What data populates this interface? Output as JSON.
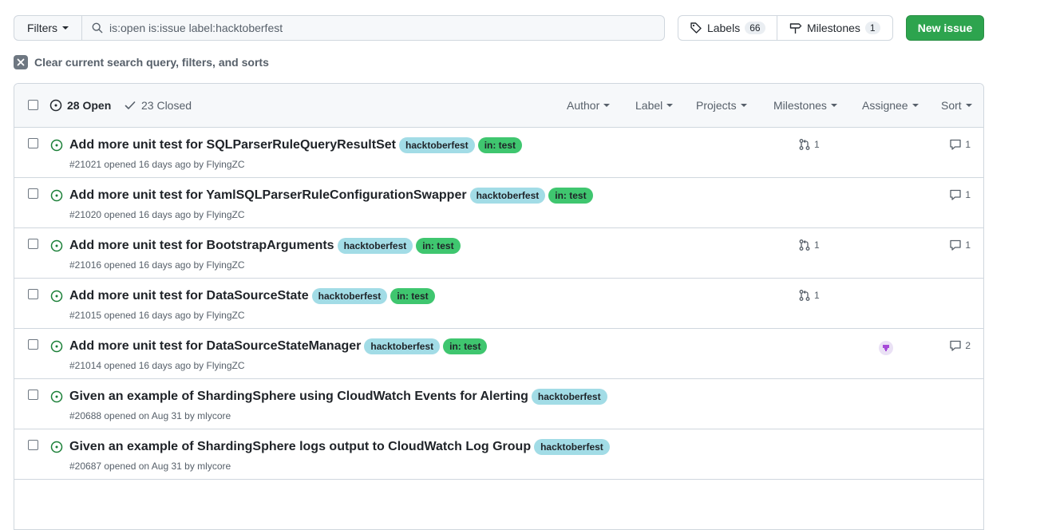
{
  "toolbar": {
    "filters_label": "Filters",
    "search_value": "is:open is:issue label:hacktoberfest",
    "labels_label": "Labels",
    "labels_count": "66",
    "milestones_label": "Milestones",
    "milestones_count": "1",
    "new_issue_label": "New issue"
  },
  "clear_query_label": "Clear current search query, filters, and sorts",
  "list_header": {
    "open_label": "28 Open",
    "closed_label": "23 Closed",
    "sorters": [
      "Author",
      "Label",
      "Projects",
      "Milestones",
      "Assignee",
      "Sort"
    ]
  },
  "colors": {
    "hacktoberfest_label": "#a2dce6",
    "in_test_label": "#3fc66f",
    "open_icon": "#1a7f37",
    "new_issue_button": "#2da44e"
  },
  "issues": [
    {
      "title": "Add more unit test for SQLParserRuleQueryResultSet",
      "labels": [
        "hacktoberfest",
        "in: test"
      ],
      "meta": "#21021 opened 16 days ago by",
      "author": "FlyingZC",
      "linked_prs": "1",
      "comments": "1"
    },
    {
      "title": "Add more unit test for YamlSQLParserRuleConfigurationSwapper",
      "labels": [
        "hacktoberfest",
        "in: test"
      ],
      "meta": "#21020 opened 16 days ago by",
      "author": "FlyingZC",
      "linked_prs": "",
      "comments": "1"
    },
    {
      "title": "Add more unit test for BootstrapArguments",
      "labels": [
        "hacktoberfest",
        "in: test"
      ],
      "meta": "#21016 opened 16 days ago by",
      "author": "FlyingZC",
      "linked_prs": "1",
      "comments": "1"
    },
    {
      "title": "Add more unit test for DataSourceState",
      "labels": [
        "hacktoberfest",
        "in: test"
      ],
      "meta": "#21015 opened 16 days ago by",
      "author": "FlyingZC",
      "linked_prs": "1",
      "comments": ""
    },
    {
      "title": "Add more unit test for DataSourceStateManager",
      "labels": [
        "hacktoberfest",
        "in: test"
      ],
      "meta": "#21014 opened 16 days ago by",
      "author": "FlyingZC",
      "linked_prs": "",
      "comments": "2",
      "assignee": true
    },
    {
      "title": "Given an example of ShardingSphere using CloudWatch Events for Alerting",
      "labels": [
        "hacktoberfest"
      ],
      "meta": "#20688 opened on Aug 31 by",
      "author": "mlycore",
      "linked_prs": "",
      "comments": ""
    },
    {
      "title": "Given an example of ShardingSphere logs output to CloudWatch Log Group",
      "labels": [
        "hacktoberfest"
      ],
      "meta": "#20687 opened on Aug 31 by",
      "author": "mlycore",
      "linked_prs": "",
      "comments": ""
    }
  ]
}
